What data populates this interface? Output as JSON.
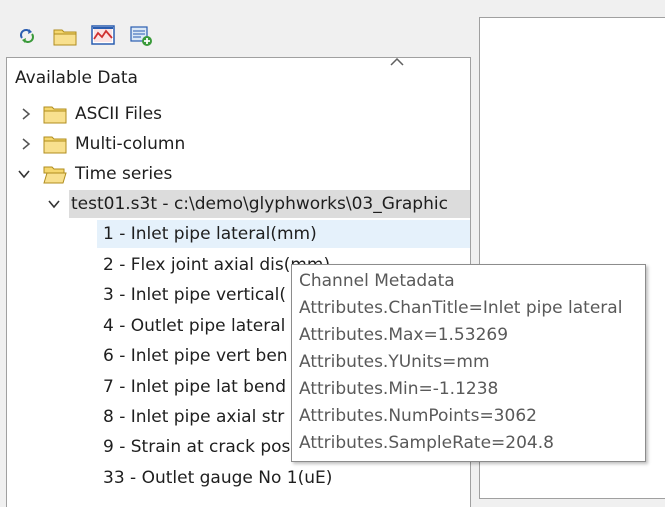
{
  "panel": {
    "title": "Available Data"
  },
  "tree": {
    "folders": [
      {
        "label": "ASCII Files",
        "expanded": false
      },
      {
        "label": "Multi-column",
        "expanded": false
      },
      {
        "label": "Time series",
        "expanded": true
      }
    ],
    "file": {
      "label": "test01.s3t - c:\\demo\\glyphworks\\03_Graphic"
    },
    "channels": [
      "1 - Inlet pipe lateral(mm)",
      "2 - Flex joint axial dis(mm)",
      "3 - Inlet pipe vertical(",
      "4 - Outlet pipe lateral",
      "6 - Inlet pipe vert ben",
      "7 - Inlet pipe lat bend",
      "8 - Inlet pipe axial str",
      "9 - Strain at crack pos",
      "33 - Outlet gauge No 1(uE)"
    ]
  },
  "tooltip": {
    "title": "Channel Metadata",
    "lines": [
      "Attributes.ChanTitle=Inlet pipe lateral",
      "Attributes.Max=1.53269",
      "Attributes.YUnits=mm",
      "Attributes.Min=-1.1238",
      "Attributes.NumPoints=3062",
      "Attributes.SampleRate=204.8"
    ]
  },
  "icons": {
    "toolbar": [
      "refresh-icon",
      "open-folder-icon",
      "display-icon",
      "add-data-icon"
    ],
    "tree": [
      "chevron-right-icon",
      "chevron-down-icon",
      "folder-icon",
      "folder-open-icon"
    ]
  },
  "colors": {
    "folder": "#f5d76e",
    "hover": "#e5f1fb",
    "selected": "#dcdcdc"
  }
}
